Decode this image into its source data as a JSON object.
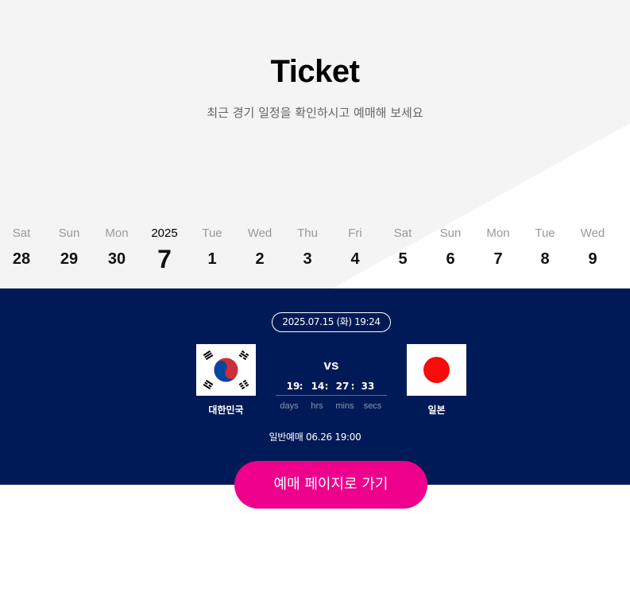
{
  "header": {
    "title": "Ticket",
    "subtitle": "최근 경기 일정을 확인하시고 예매해 보세요"
  },
  "calendar": {
    "days": [
      {
        "dow": "Sat",
        "num": "28"
      },
      {
        "dow": "Sun",
        "num": "29"
      },
      {
        "dow": "Mon",
        "num": "30"
      },
      {
        "dow": "2025",
        "num": "7",
        "current": true
      },
      {
        "dow": "Tue",
        "num": "1"
      },
      {
        "dow": "Wed",
        "num": "2"
      },
      {
        "dow": "Thu",
        "num": "3"
      },
      {
        "dow": "Fri",
        "num": "4"
      },
      {
        "dow": "Sat",
        "num": "5"
      },
      {
        "dow": "Sun",
        "num": "6"
      },
      {
        "dow": "Mon",
        "num": "7"
      },
      {
        "dow": "Tue",
        "num": "8"
      },
      {
        "dow": "Wed",
        "num": "9"
      }
    ]
  },
  "match": {
    "datetime": "2025.07.15 (화) 19:24",
    "home_team": "대한민국",
    "away_team": "일본",
    "vs": "vs",
    "countdown": {
      "days": "19",
      "hrs": "14",
      "mins": "27",
      "secs": "33",
      "sep": ":"
    },
    "units": {
      "days": "days",
      "hrs": "hrs",
      "mins": "mins",
      "secs": "secs"
    },
    "presale": "일반예매 06.26 19:00"
  },
  "cta": {
    "label": "예매 페이지로 가기"
  },
  "colors": {
    "navy": "#001a57",
    "accent": "#ee008c",
    "korea_red": "#cd2e3a",
    "korea_blue": "#0047a0",
    "japan_red": "#bc002d"
  }
}
